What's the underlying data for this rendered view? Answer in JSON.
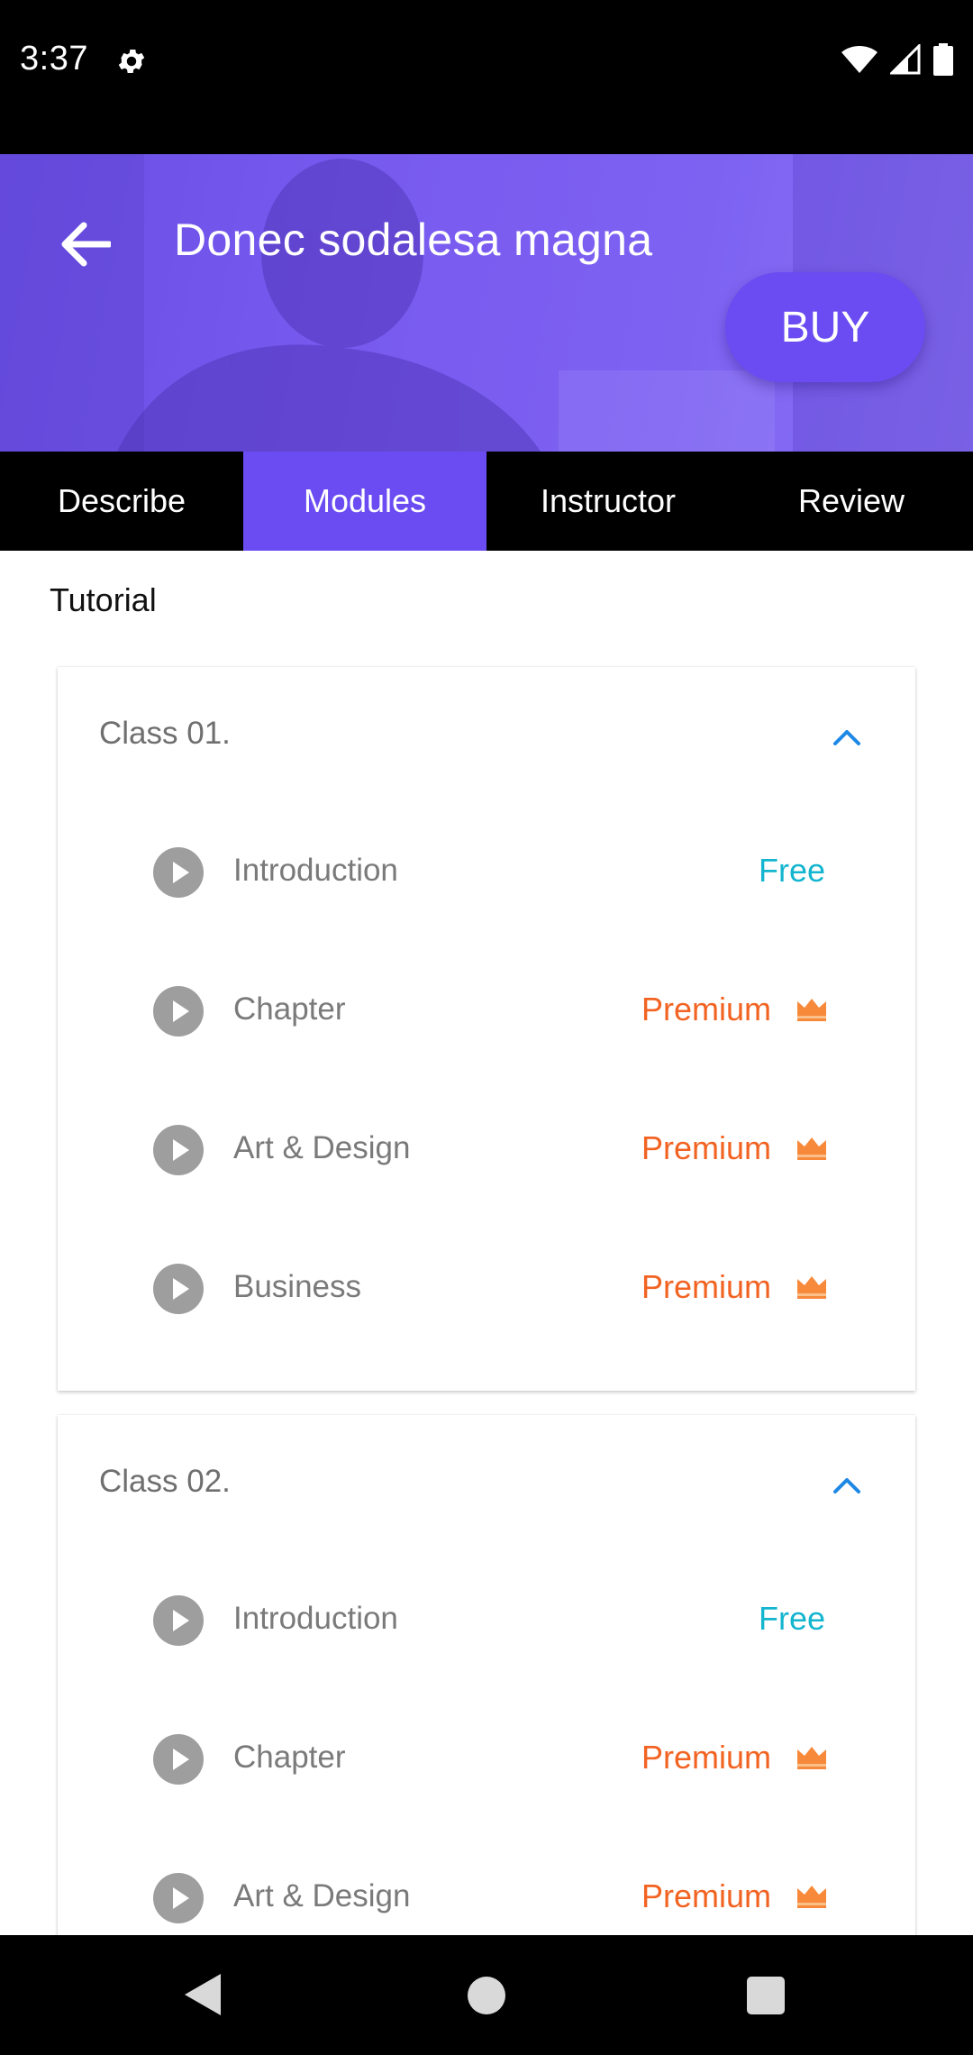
{
  "status_bar": {
    "time": "3:37"
  },
  "header": {
    "title": "Donec sodalesa magna",
    "buy_label": "BUY"
  },
  "tabs": [
    {
      "label": "Describe",
      "active": false
    },
    {
      "label": "Modules",
      "active": true
    },
    {
      "label": "Instructor",
      "active": false
    },
    {
      "label": "Review",
      "active": false
    }
  ],
  "section_title": "Tutorial",
  "classes": [
    {
      "title": "Class 01.",
      "lessons": [
        {
          "name": "Introduction",
          "access": "Free"
        },
        {
          "name": "Chapter",
          "access": "Premium"
        },
        {
          "name": "Art & Design",
          "access": "Premium"
        },
        {
          "name": "Business",
          "access": "Premium"
        }
      ]
    },
    {
      "title": "Class 02.",
      "lessons": [
        {
          "name": "Introduction",
          "access": "Free"
        },
        {
          "name": "Chapter",
          "access": "Premium"
        },
        {
          "name": "Art & Design",
          "access": "Premium"
        }
      ]
    }
  ],
  "icons": {
    "status": [
      "gear-icon",
      "wifi-icon",
      "signal-icon",
      "battery-icon"
    ],
    "header": "back-arrow-icon",
    "lesson": "play-icon",
    "premium": "crown-icon",
    "expand": "chevron-up-icon",
    "nav": [
      "nav-back-icon",
      "nav-home-icon",
      "nav-recents-icon"
    ]
  },
  "colors": {
    "accent": "#6a4cf2",
    "free": "#13b5cf",
    "premium": "#f26322",
    "crown": "#f7893b",
    "chevron": "#1e88e5"
  }
}
